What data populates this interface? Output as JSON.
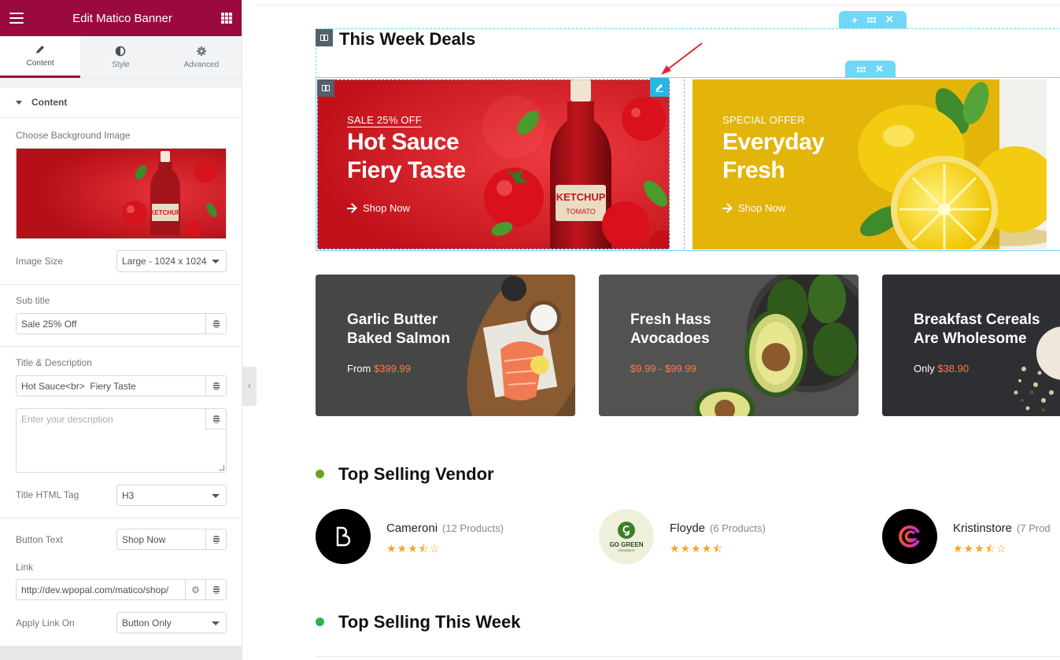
{
  "sidebar": {
    "title": "Edit Matico Banner",
    "tabs": [
      {
        "label": "Content"
      },
      {
        "label": "Style"
      },
      {
        "label": "Advanced"
      }
    ],
    "section_title": "Content",
    "bg_image_label": "Choose Background Image",
    "image_size_label": "Image Size",
    "image_size_value": "Large - 1024 x 1024",
    "subtitle_label": "Sub title",
    "subtitle_value": "Sale 25% Off",
    "title_desc_label": "Title & Description",
    "title_value": "Hot Sauce<br>  Fiery Taste",
    "description_placeholder": "Enter your description",
    "title_tag_label": "Title HTML Tag",
    "title_tag_value": "H3",
    "button_text_label": "Button Text",
    "button_text_value": "Shop Now",
    "link_label": "Link",
    "link_value": "http://dev.wpopal.com/matico/shop/",
    "apply_link_label": "Apply Link On",
    "apply_link_value": "Button Only"
  },
  "preview": {
    "section_title": "This Week Deals",
    "banners": [
      {
        "subtitle": "SALE 25% OFF",
        "title_line1": "Hot Sauce",
        "title_line2": "Fiery Taste",
        "button": "Shop Now",
        "label": "KETCHUP",
        "label2": "TOMATO"
      },
      {
        "subtitle": "SPECIAL OFFER",
        "title_line1": "Everyday",
        "title_line2": "Fresh",
        "button": "Shop Now"
      }
    ],
    "cards": [
      {
        "line1": "Garlic Butter",
        "line2": "Baked Salmon",
        "price_prefix": "From ",
        "price": "$399.99"
      },
      {
        "line1": "Fresh Hass",
        "line2": "Avocadoes",
        "price_prefix": "",
        "price": "$9.99 - $99.99"
      },
      {
        "line1": "Breakfast Cereals",
        "line2": "Are Wholesome",
        "price_prefix": "Only ",
        "price": "$38.90"
      }
    ],
    "vendor_section_title": "Top Selling Vendor",
    "vendors": [
      {
        "name": "Cameroni",
        "count": "(12 Products)",
        "rating": 3.5,
        "stars": "★★★⯪☆"
      },
      {
        "name": "Floyde",
        "count": "(6 Products)",
        "rating": 4.5,
        "stars": "★★★★⯪",
        "logo_text": "GO GREEN",
        "logo_sub": "ORGANICS"
      },
      {
        "name": "Kristinstore",
        "count": "(7 Prod",
        "rating": 3.5,
        "stars": "★★★⯪☆"
      }
    ],
    "week_section_title": "Top Selling This Week"
  },
  "colors": {
    "brand": "#9b0a3f",
    "editor_accent": "#71d7f7",
    "banner_red": "#c9151f",
    "banner_yellow": "#e3b409",
    "price_orange": "#ff7a45",
    "star": "#f5a623"
  },
  "icons": [
    "hamburger-icon",
    "grid-icon",
    "pencil-icon",
    "contrast-icon",
    "gear-icon",
    "database-icon",
    "columns-icon",
    "drag-icon",
    "plus-icon",
    "close-icon",
    "arrow-right-icon",
    "chevron-left-icon"
  ]
}
